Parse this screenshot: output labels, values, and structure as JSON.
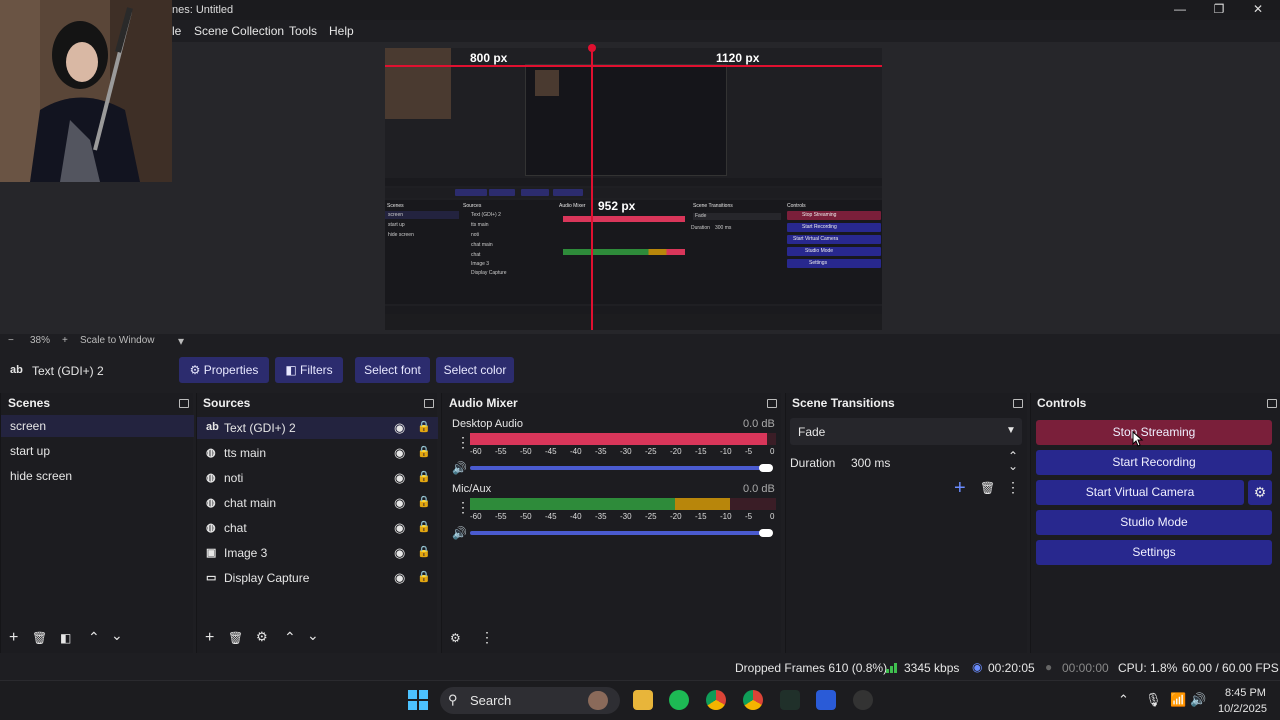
{
  "window": {
    "title": "nes: Untitled",
    "minimize": "—",
    "maximize": "❐",
    "close": "✕"
  },
  "menu": [
    "le",
    "Scene Collection",
    "Tools",
    "Help"
  ],
  "zoom": {
    "minus": "−",
    "percent": "38%",
    "plus": "+",
    "mode": "Scale to Window",
    "arrow": "▾"
  },
  "measure": {
    "left": "800 px",
    "top": "1120 px",
    "bottom": "952 px"
  },
  "nested": {
    "left": "800 px",
    "top": "1120 px",
    "mid": "952 px",
    "panels": [
      "Scenes",
      "Sources",
      "Audio Mixer",
      "Scene Transitions",
      "Controls"
    ],
    "scene_items": [
      "screen",
      "start up",
      "hide screen"
    ],
    "src_items": [
      "Text (GDI+) 2",
      "tts main",
      "noti",
      "chat main",
      "chat",
      "Image 3",
      "Display Capture"
    ],
    "ctl": [
      "Stop Streaming",
      "Start Recording",
      "Start Virtual Camera",
      "Studio Mode",
      "Settings"
    ],
    "trans": "Fade",
    "dur": "Duration",
    "dur_val": "300 ms"
  },
  "props": {
    "source": "Text (GDI+) 2",
    "source_icon": "ab",
    "properties": "Properties",
    "filters": "Filters",
    "select_font": "Select font",
    "select_color": "Select color"
  },
  "scenes": {
    "title": "Scenes",
    "items": [
      "screen",
      "start up",
      "hide screen"
    ]
  },
  "sources": {
    "title": "Sources",
    "items": [
      {
        "name": "Text (GDI+) 2",
        "icon": "text-icon"
      },
      {
        "name": "tts main",
        "icon": "globe-icon"
      },
      {
        "name": "noti",
        "icon": "globe-icon"
      },
      {
        "name": "chat main",
        "icon": "globe-icon"
      },
      {
        "name": "chat",
        "icon": "globe-icon"
      },
      {
        "name": "Image 3",
        "icon": "image-icon"
      },
      {
        "name": "Display Capture",
        "icon": "monitor-icon"
      }
    ]
  },
  "mixer": {
    "title": "Audio Mixer",
    "channels": [
      {
        "name": "Desktop Audio",
        "db": "0.0 dB",
        "level": 0.97
      },
      {
        "name": "Mic/Aux",
        "db": "0.0 dB",
        "level": 0.78
      }
    ],
    "ticks": [
      "-60",
      "-55",
      "-50",
      "-45",
      "-40",
      "-35",
      "-30",
      "-25",
      "-20",
      "-15",
      "-10",
      "-5",
      "0"
    ]
  },
  "transitions": {
    "title": "Scene Transitions",
    "selected": "Fade",
    "duration_label": "Duration",
    "duration_value": "300 ms"
  },
  "controls": {
    "title": "Controls",
    "buttons": [
      "Stop Streaming",
      "Start Recording",
      "Start Virtual Camera",
      "Studio Mode",
      "Settings"
    ]
  },
  "status": {
    "dropped": "Dropped Frames 610 (0.8%)",
    "kbps": "3345 kbps",
    "stream_time": "00:20:05",
    "rec_time": "00:00:00",
    "cpu": "CPU: 1.8%",
    "fps": "60.00 / 60.00 FPS"
  },
  "taskbar": {
    "search": "Search",
    "time": "8:45 PM",
    "date": "10/2/2025"
  },
  "colors": {
    "accent": "#28288e",
    "stop": "#7a1f3a",
    "meter_red": "#d9365a",
    "meter_green": "#2e8b3a",
    "meter_yellow": "#b8860b"
  }
}
